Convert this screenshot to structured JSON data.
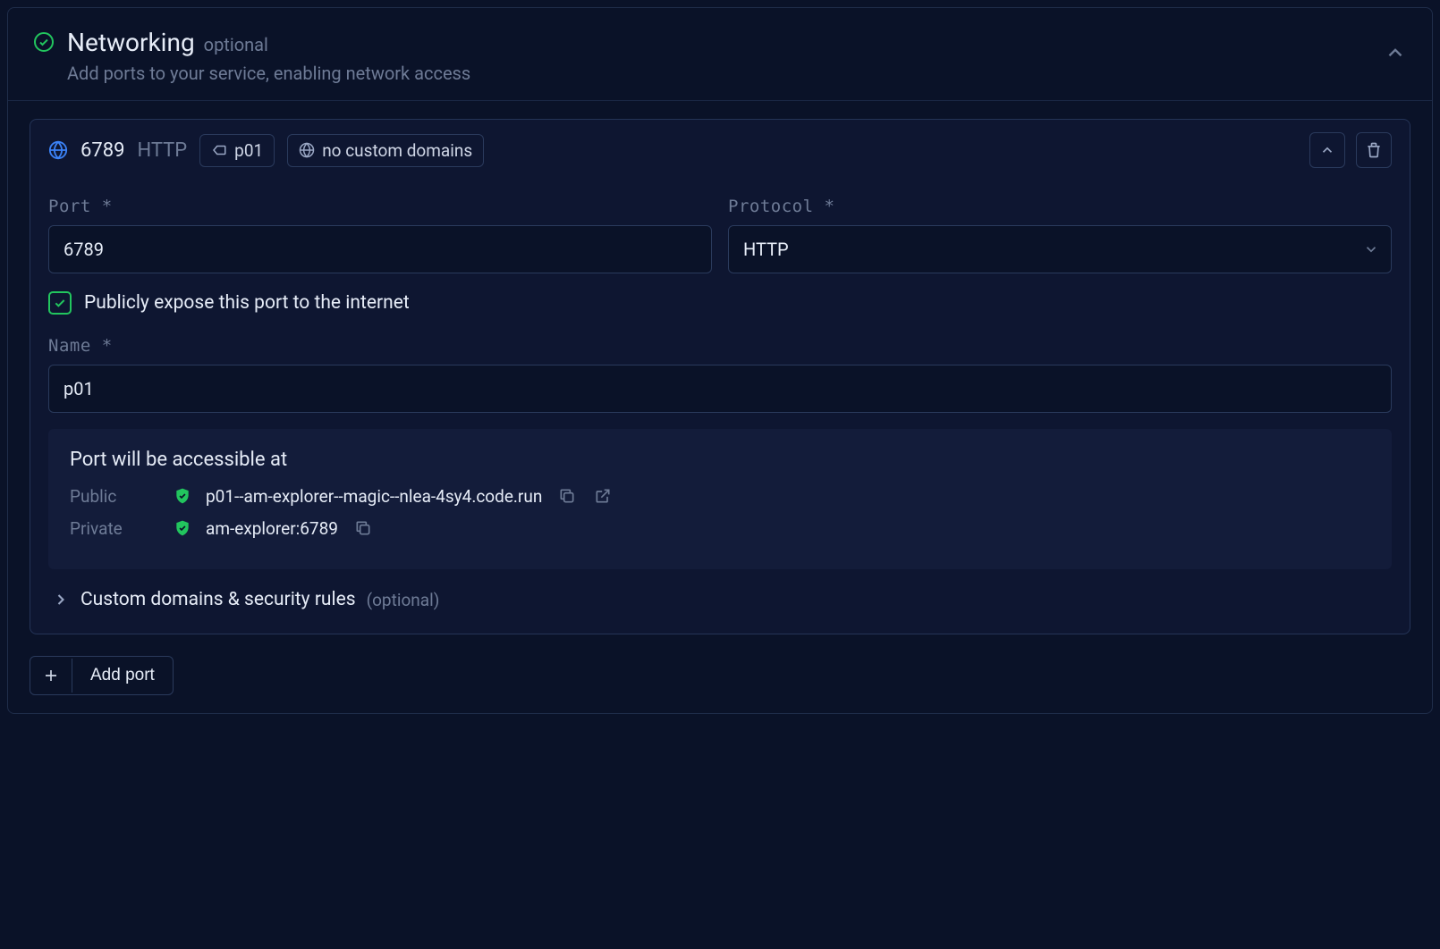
{
  "section": {
    "title": "Networking",
    "optional_tag": "optional",
    "subtitle": "Add ports to your service, enabling network access"
  },
  "port": {
    "header_port": "6789",
    "header_protocol": "HTTP",
    "badge_name": "p01",
    "badge_domains": "no custom domains",
    "form": {
      "port_label": "Port *",
      "port_value": "6789",
      "protocol_label": "Protocol *",
      "protocol_value": "HTTP",
      "expose_label": "Publicly expose this port to the internet",
      "name_label": "Name *",
      "name_value": "p01"
    },
    "access": {
      "title": "Port will be accessible at",
      "public_label": "Public",
      "public_url": "p01--am-explorer--magic--nlea-4sy4.code.run",
      "private_label": "Private",
      "private_url": "am-explorer:6789"
    },
    "custom_domains": {
      "label": "Custom domains & security rules",
      "optional": "(optional)"
    }
  },
  "add_port_label": "Add port"
}
